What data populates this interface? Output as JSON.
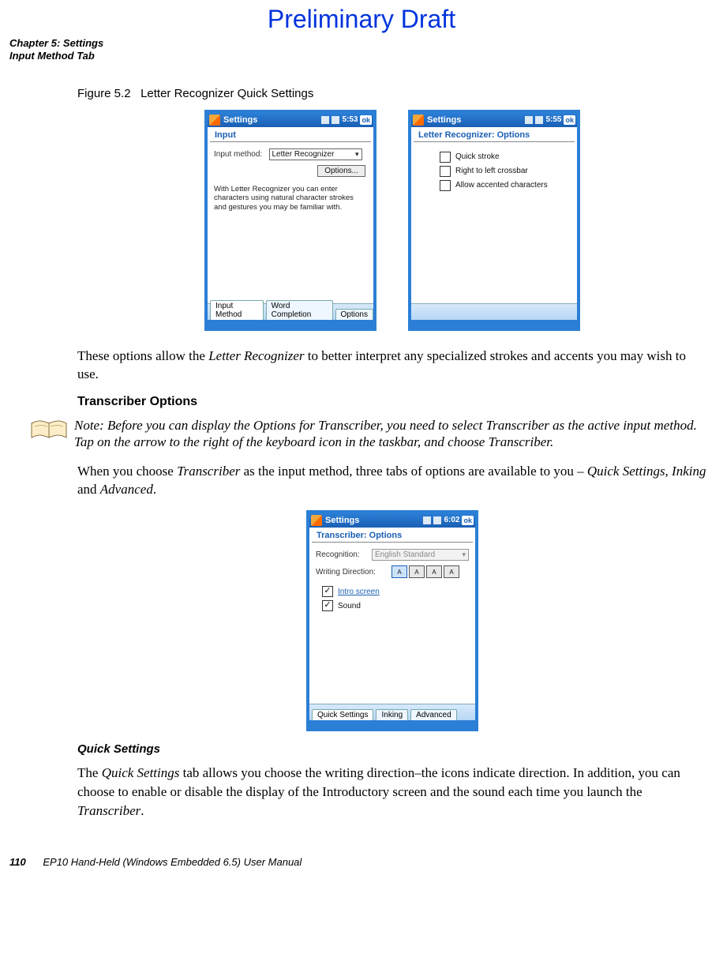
{
  "watermark": "Preliminary Draft",
  "chapter": {
    "line1": "Chapter 5: Settings",
    "line2": "Input Method Tab"
  },
  "figure_caption_prefix": "Figure 5.2",
  "figure_caption_title": "Letter Recognizer Quick Settings",
  "pda_left": {
    "app": "Settings",
    "time": "5:53",
    "ok": "ok",
    "subtitle": "Input",
    "label_input_method": "Input method:",
    "selected_method": "Letter Recognizer",
    "options_btn": "Options...",
    "help": "With Letter Recognizer you can enter characters using natural character strokes and gestures you may be familiar with.",
    "tabs": [
      "Input Method",
      "Word Completion",
      "Options"
    ]
  },
  "pda_right": {
    "app": "Settings",
    "time": "5:55",
    "ok": "ok",
    "subtitle": "Letter Recognizer: Options",
    "opts": [
      "Quick stroke",
      "Right to left crossbar",
      "Allow accented characters"
    ]
  },
  "para_after_fig": "These options allow the Letter Recognizer to better interpret any specialized strokes and accents you may wish to use.",
  "para_after_fig_em": "Letter Recognizer",
  "heading_transcriber": "Transcriber Options",
  "note": {
    "label": "Note:",
    "text": "Before you can display the Options for Transcriber, you need to select Transcriber as the active input method. Tap on the arrow to the right of the keyboard icon in the taskbar, and choose Transcriber."
  },
  "para_transcriber": {
    "pre": "When you choose ",
    "em1": "Transcriber",
    "mid": " as the input method, three tabs of options are available to you – ",
    "em2": "Quick Settings, Inking",
    "mid2": " and ",
    "em3": "Advanced",
    "post": "."
  },
  "pda_trans": {
    "app": "Settings",
    "time": "6:02",
    "ok": "ok",
    "subtitle": "Transcriber: Options",
    "label_recognition": "Recognition:",
    "recognition_value": "English Standard",
    "label_wd": "Writing Direction:",
    "cb_intro": "Intro screen",
    "cb_sound": "Sound",
    "tabs": [
      "Quick Settings",
      "Inking",
      "Advanced"
    ]
  },
  "heading_quick": "Quick Settings",
  "para_quick": {
    "pre": "The ",
    "em1": "Quick Settings",
    "mid": " tab allows you choose the writing direction–the icons indicate direction. In addition, you can choose to enable or disable the display of the Introductory screen and the sound each time you launch the ",
    "em2": "Transcriber",
    "post": "."
  },
  "footer": {
    "page": "110",
    "title": "EP10 Hand-Held (Windows Embedded 6.5) User Manual"
  }
}
